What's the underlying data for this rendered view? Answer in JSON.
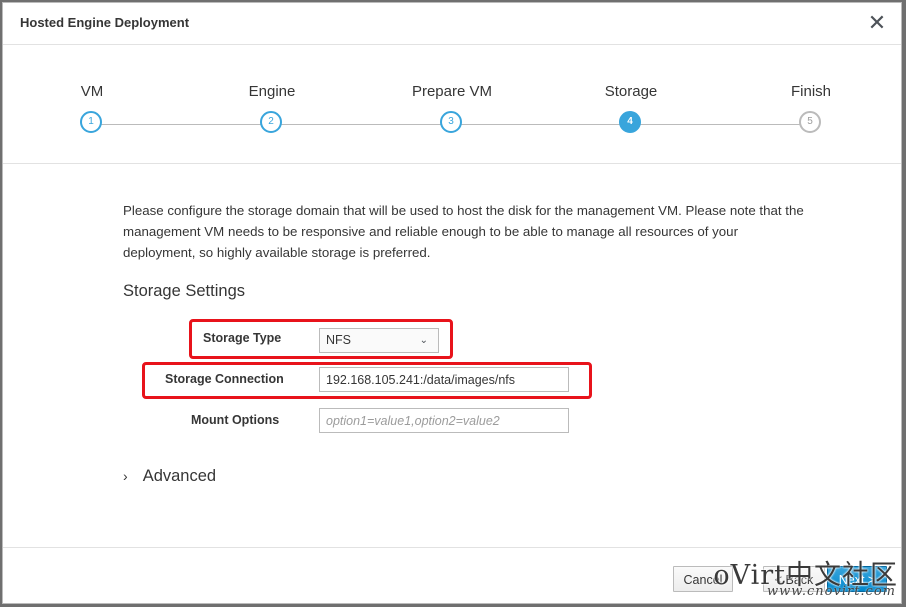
{
  "dialog": {
    "title": "Hosted Engine Deployment",
    "close_label": "✕"
  },
  "steps": [
    {
      "label": "VM",
      "number": "1",
      "state": "done"
    },
    {
      "label": "Engine",
      "number": "2",
      "state": "done"
    },
    {
      "label": "Prepare VM",
      "number": "3",
      "state": "done"
    },
    {
      "label": "Storage",
      "number": "4",
      "state": "active"
    },
    {
      "label": "Finish",
      "number": "5",
      "state": "disabled"
    }
  ],
  "intro_text": "Please configure the storage domain that will be used to host the disk for the management VM. Please note that the management VM needs to be responsive and reliable enough to be able to manage all resources of your deployment, so highly available storage is preferred.",
  "storage_settings": {
    "section_title": "Storage Settings",
    "storage_type_label": "Storage Type",
    "storage_type_value": "NFS",
    "storage_connection_label": "Storage Connection",
    "storage_connection_value": "192.168.105.241:/data/images/nfs",
    "mount_options_label": "Mount Options",
    "mount_options_placeholder": "option1=value1,option2=value2"
  },
  "advanced": {
    "label": "Advanced"
  },
  "footer": {
    "cancel_label": "Cancel",
    "back_label": "< Back",
    "next_label": "Next >"
  },
  "watermark": {
    "main": "oVirt中文社区",
    "url": "www.cnovirt.com"
  },
  "colors": {
    "accent": "#39a5dc",
    "highlight": "#e8131b",
    "primary_button": "#0088ce"
  },
  "icons": {
    "close": "close-icon",
    "select_chevron": "chevron-down-icon",
    "advanced_caret": "chevron-right-icon"
  }
}
